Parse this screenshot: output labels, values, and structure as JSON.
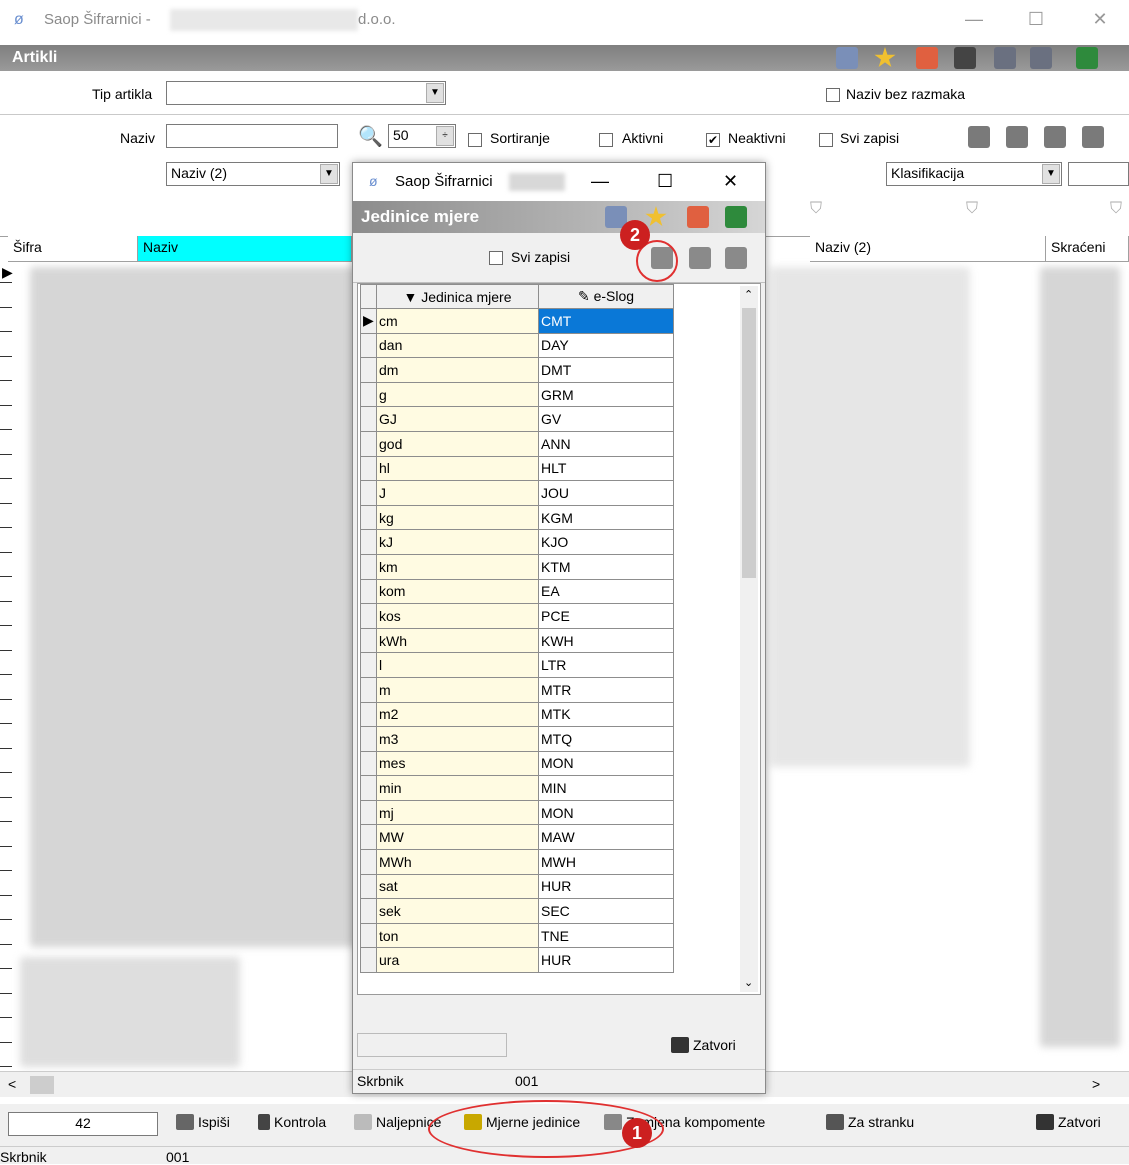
{
  "titlebar": {
    "app": "Saop Šifrarnici -",
    "suffix": "d.o.o.",
    "minimize": "—",
    "maximize": "☐",
    "close": "✕"
  },
  "artikli": {
    "title": "Artikli",
    "tip_artikla_label": "Tip artikla",
    "tip_artikla_value": "",
    "naziv_bez_razmaka": "Naziv bez razmaka",
    "naziv_label": "Naziv",
    "naziv_value": "",
    "count": "50",
    "sortiranje": "Sortiranje",
    "aktivni": "Aktivni",
    "neaktivni": "Neaktivni",
    "svi_zapisi": "Svi zapisi",
    "naziv2_dropdown": "Naziv (2)",
    "klasifikacija_dropdown": "Klasifikacija"
  },
  "grid": {
    "columns": [
      "Šifra",
      "Naziv",
      "Naziv (2)",
      "Skraćeni"
    ]
  },
  "dialog": {
    "title": "Saop Šifrarnici",
    "subtitle": "Jedinice mjere",
    "svi_zapisi": "Svi zapisi",
    "col_unit": "Jedinica mjere",
    "col_eslog": "e-Slog",
    "rows": [
      [
        "cm",
        "CMT"
      ],
      [
        "dan",
        "DAY"
      ],
      [
        "dm",
        "DMT"
      ],
      [
        "g",
        "GRM"
      ],
      [
        "GJ",
        "GV"
      ],
      [
        "god",
        "ANN"
      ],
      [
        "hl",
        "HLT"
      ],
      [
        "J",
        "JOU"
      ],
      [
        "kg",
        "KGM"
      ],
      [
        "kJ",
        "KJO"
      ],
      [
        "km",
        "KTM"
      ],
      [
        "kom",
        "EA"
      ],
      [
        "kos",
        "PCE"
      ],
      [
        "kWh",
        "KWH"
      ],
      [
        "l",
        "LTR"
      ],
      [
        "m",
        "MTR"
      ],
      [
        "m2",
        "MTK"
      ],
      [
        "m3",
        "MTQ"
      ],
      [
        "mes",
        "MON"
      ],
      [
        "min",
        "MIN"
      ],
      [
        "mj",
        "MON"
      ],
      [
        "MW",
        "MAW"
      ],
      [
        "MWh",
        "MWH"
      ],
      [
        "sat",
        "HUR"
      ],
      [
        "sek",
        "SEC"
      ],
      [
        "ton",
        "TNE"
      ],
      [
        "ura",
        "HUR"
      ]
    ],
    "zatvori": "Zatvori",
    "status_label": "Skrbnik",
    "status_value": "001"
  },
  "bottom": {
    "count": "42",
    "ispisi": "Ispiši",
    "kontrola": "Kontrola",
    "naljepnice": "Naljepnice",
    "mjerne_jedinice": "Mjerne jedinice",
    "zamjena": "Zamjena kompomente",
    "za_stranku": "Za stranku",
    "zatvori": "Zatvori"
  },
  "status": {
    "label": "Skrbnik",
    "value": "001"
  },
  "annotations": {
    "one": "1",
    "two": "2"
  },
  "colors": {
    "selection": "#0a78d7",
    "yellow_cell": "#fffbe2",
    "header_gray": "#8c8c8c",
    "naziv_header": "#00ffff",
    "annotation_red": "#cc2020"
  }
}
